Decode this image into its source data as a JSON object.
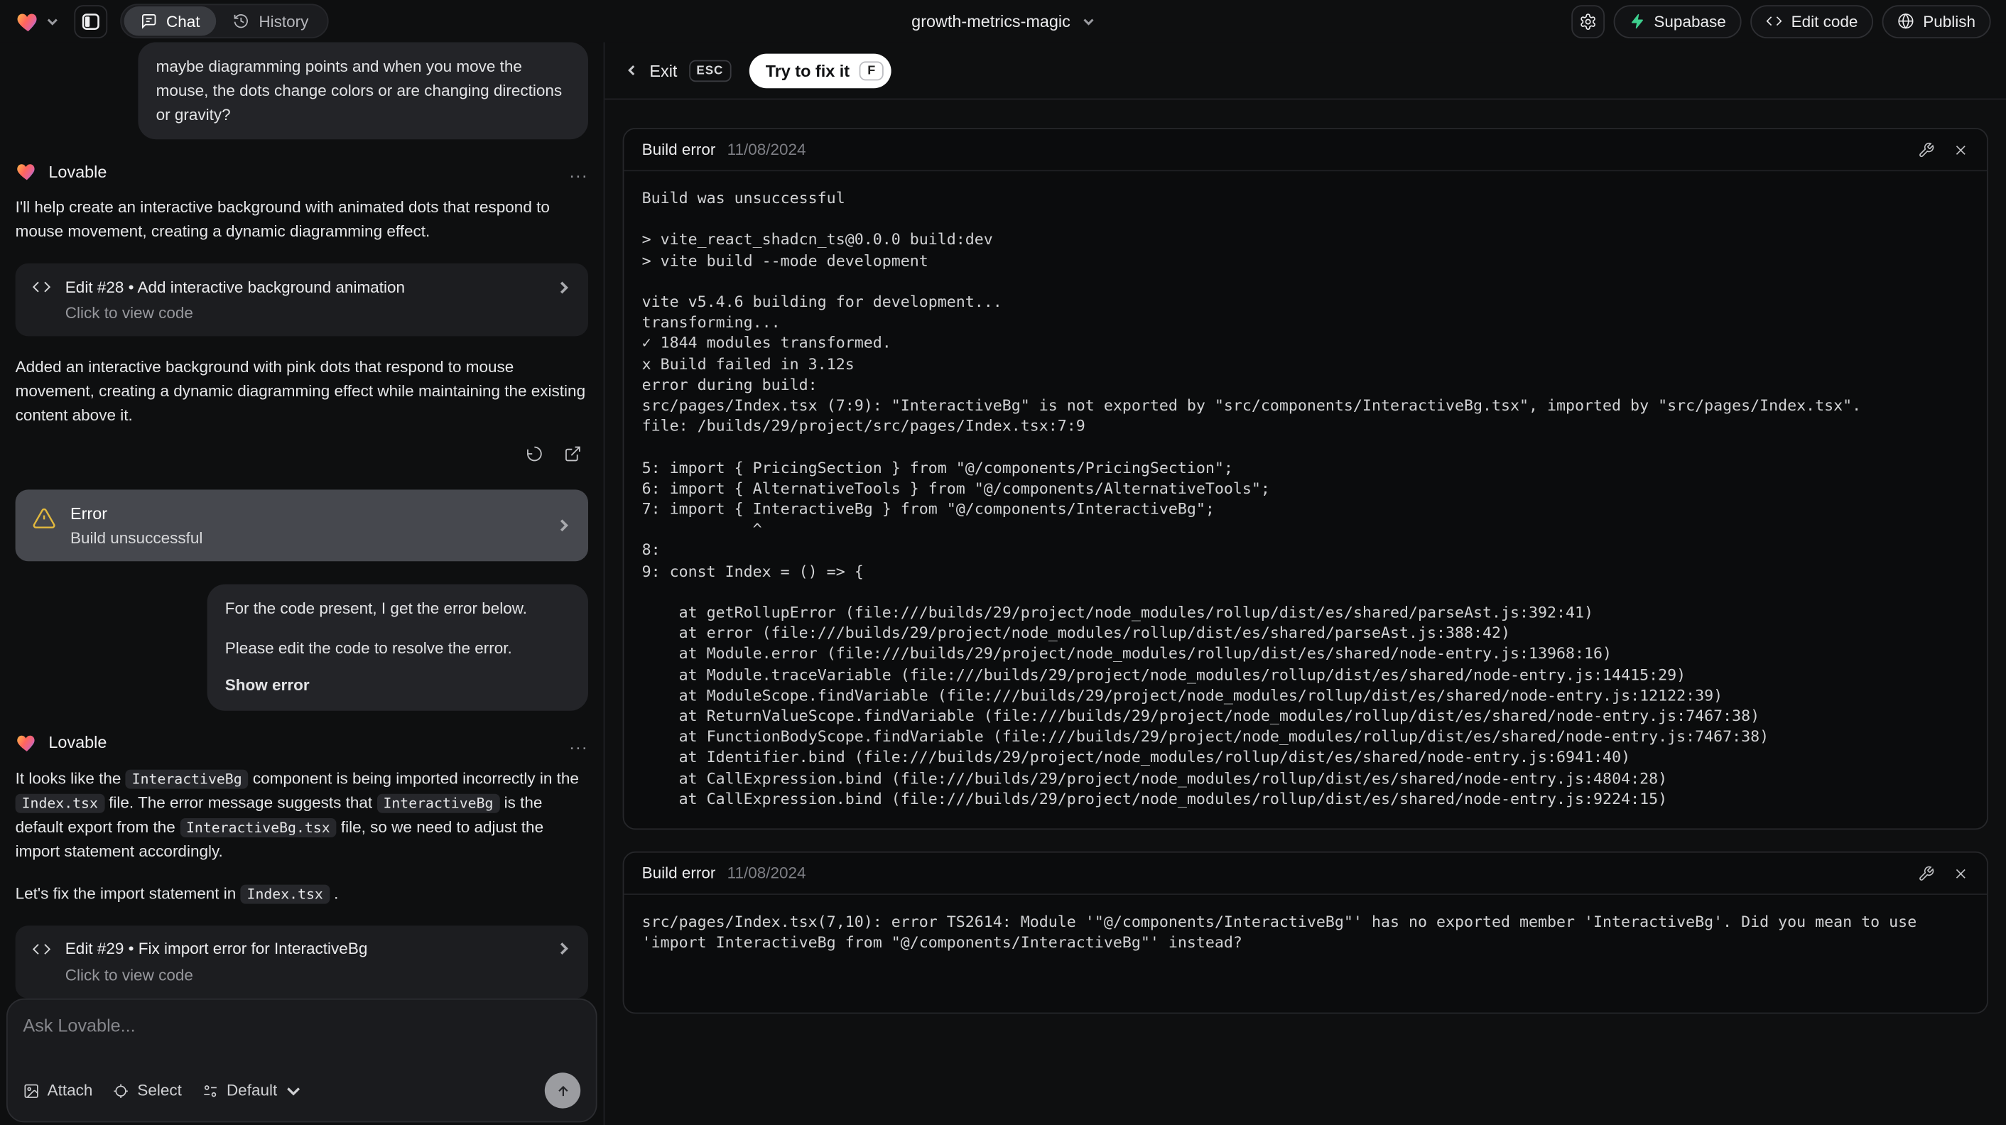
{
  "top_bar": {
    "tabs": {
      "chat": "Chat",
      "history": "History"
    },
    "project_name": "growth-metrics-magic",
    "supabase_label": "Supabase",
    "edit_code_label": "Edit code",
    "publish_label": "Publish"
  },
  "colors": {
    "supabase_green": "#3ecf8e",
    "warning_yellow": "#e2b93e",
    "panel_bg": "#0b0c0d",
    "error_card_bg": "#46484e"
  },
  "chat": {
    "assistant_name": "Lovable",
    "menu_ellipsis": "...",
    "user_message_1": "maybe diagramming points and when you move the mouse, the dots change colors or are changing directions or gravity?",
    "assistant_message_1": "I'll help create an interactive background with animated dots that respond to mouse movement, creating a dynamic diagramming effect.",
    "edit_card_28": {
      "title": "Edit #28 • Add interactive background animation",
      "subtitle": "Click to view code"
    },
    "assistant_message_2": "Added an interactive background with pink dots that respond to mouse movement, creating a dynamic diagramming effect while maintaining the existing content above it.",
    "error_card": {
      "title": "Error",
      "subtitle": "Build unsuccessful"
    },
    "user_message_2": {
      "line1": "For the code present, I get the error below.",
      "line2": "Please edit the code to resolve the error.",
      "action": "Show error"
    },
    "fix_message": {
      "s1": "It looks like the ",
      "c1": "InteractiveBg",
      "s2": " component is being imported incorrectly in the ",
      "c2": "Index.tsx",
      "s3": " file. The error message suggests that ",
      "c3": "InteractiveBg",
      "s4": " is the default export from the ",
      "c4": "InteractiveBg.tsx",
      "s5": " file, so we need to adjust the import statement accordingly.",
      "s6": "Let's fix the import statement in ",
      "c5": "Index.tsx",
      "s7": " ."
    },
    "edit_card_29": {
      "title": "Edit #29 • Fix import error for InteractiveBg",
      "subtitle": "Click to view code"
    }
  },
  "composer": {
    "placeholder": "Ask Lovable...",
    "attach": "Attach",
    "select": "Select",
    "mode": "Default"
  },
  "fix_bar": {
    "exit": "Exit",
    "esc": "ESC",
    "try_fix": "Try to fix it",
    "key": "F"
  },
  "panels": [
    {
      "title": "Build error",
      "date": "11/08/2024",
      "lines": [
        "Build was unsuccessful",
        "",
        "> vite_react_shadcn_ts@0.0.0 build:dev",
        "> vite build --mode development",
        "",
        "vite v5.4.6 building for development...",
        "transforming...",
        "✓ 1844 modules transformed.",
        "x Build failed in 3.12s",
        "error during build:",
        "src/pages/Index.tsx (7:9): \"InteractiveBg\" is not exported by \"src/components/InteractiveBg.tsx\", imported by \"src/pages/Index.tsx\".",
        "file: /builds/29/project/src/pages/Index.tsx:7:9",
        "",
        "5: import { PricingSection } from \"@/components/PricingSection\";",
        "6: import { AlternativeTools } from \"@/components/AlternativeTools\";",
        "7: import { InteractiveBg } from \"@/components/InteractiveBg\";",
        "            ^",
        "8:",
        "9: const Index = () => {",
        "",
        "    at getRollupError (file:///builds/29/project/node_modules/rollup/dist/es/shared/parseAst.js:392:41)",
        "    at error (file:///builds/29/project/node_modules/rollup/dist/es/shared/parseAst.js:388:42)",
        "    at Module.error (file:///builds/29/project/node_modules/rollup/dist/es/shared/node-entry.js:13968:16)",
        "    at Module.traceVariable (file:///builds/29/project/node_modules/rollup/dist/es/shared/node-entry.js:14415:29)",
        "    at ModuleScope.findVariable (file:///builds/29/project/node_modules/rollup/dist/es/shared/node-entry.js:12122:39)",
        "    at ReturnValueScope.findVariable (file:///builds/29/project/node_modules/rollup/dist/es/shared/node-entry.js:7467:38)",
        "    at FunctionBodyScope.findVariable (file:///builds/29/project/node_modules/rollup/dist/es/shared/node-entry.js:7467:38)",
        "    at Identifier.bind (file:///builds/29/project/node_modules/rollup/dist/es/shared/node-entry.js:6941:40)",
        "    at CallExpression.bind (file:///builds/29/project/node_modules/rollup/dist/es/shared/node-entry.js:4804:28)",
        "    at CallExpression.bind (file:///builds/29/project/node_modules/rollup/dist/es/shared/node-entry.js:9224:15)"
      ]
    },
    {
      "title": "Build error",
      "date": "11/08/2024",
      "lines": [
        "src/pages/Index.tsx(7,10): error TS2614: Module '\"@/components/InteractiveBg\"' has no exported member 'InteractiveBg'. Did you mean to use 'import InteractiveBg from \"@/components/InteractiveBg\"' instead?"
      ]
    }
  ]
}
